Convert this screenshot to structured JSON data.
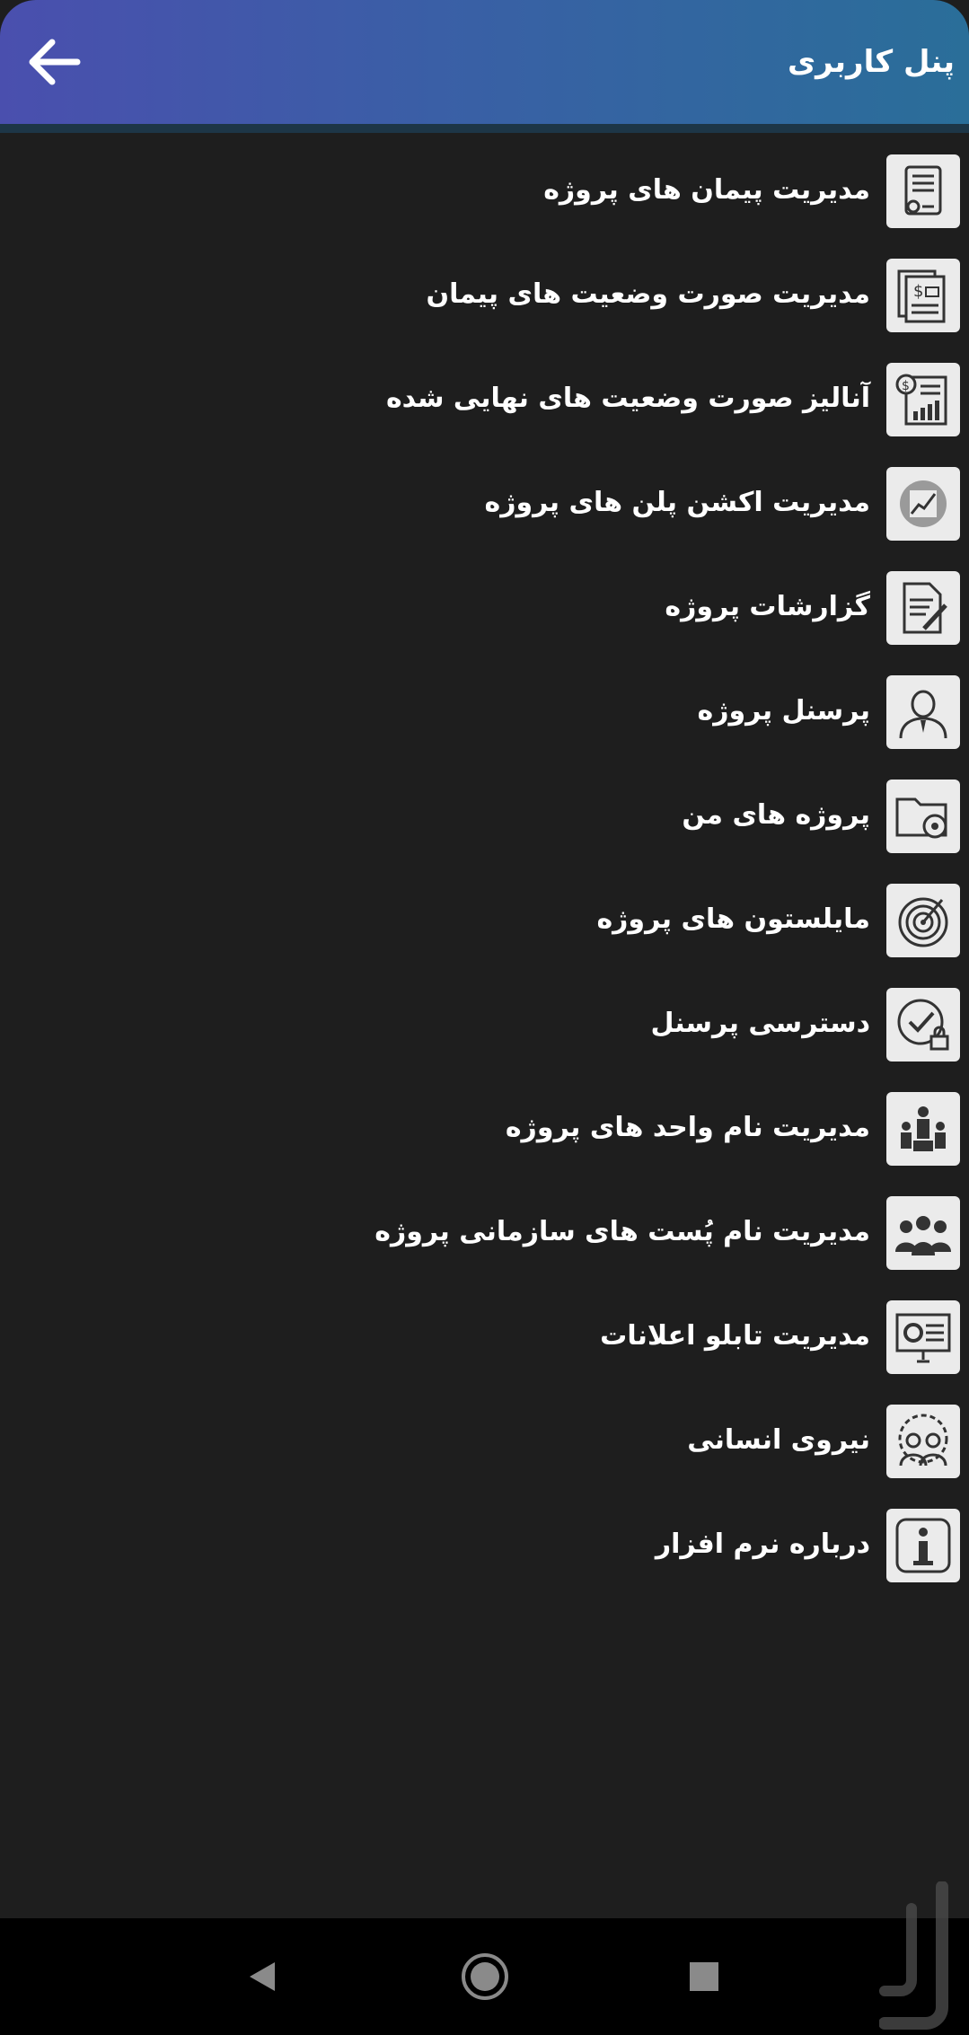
{
  "appbar": {
    "title": "پنل کاربری",
    "back_icon": "arrow-left-icon",
    "gradient": [
      "#4a4fae",
      "#2a6e99"
    ]
  },
  "menu": {
    "items": [
      {
        "label": "مدیریت پیمان های پروژه",
        "icon": "contract-document-icon"
      },
      {
        "label": "مدیریت صورت وضعیت های پیمان",
        "icon": "invoice-stack-icon"
      },
      {
        "label": "آنالیز صورت وضعیت های نهایی شده",
        "icon": "financial-report-icon"
      },
      {
        "label": "مدیریت اکشن پلن های پروژه",
        "icon": "trend-chart-icon"
      },
      {
        "label": "گزارشات پروژه",
        "icon": "report-edit-icon"
      },
      {
        "label": "پرسنل پروژه",
        "icon": "businessman-icon"
      },
      {
        "label": "پروژه های من",
        "icon": "folder-settings-icon"
      },
      {
        "label": "مایلستون های پروژه",
        "icon": "target-milestone-icon"
      },
      {
        "label": "دسترسی پرسنل",
        "icon": "access-check-lock-icon"
      },
      {
        "label": "مدیریت نام واحد های پروژه",
        "icon": "units-people-icon"
      },
      {
        "label": "مدیریت نام پُست های سازمانی پروژه",
        "icon": "team-positions-icon"
      },
      {
        "label": "مدیریت تابلو اعلانات",
        "icon": "notice-board-icon"
      },
      {
        "label": "نیروی انسانی",
        "icon": "workforce-gear-icon"
      },
      {
        "label": "درباره نرم افزار",
        "icon": "info-icon"
      }
    ]
  },
  "navbar": {
    "back_icon": "nav-back-triangle-icon",
    "home_icon": "nav-home-circle-icon",
    "recents_icon": "nav-recents-square-icon"
  },
  "colors": {
    "background": "#1e1e1e",
    "text": "#ffffff",
    "icon_tile": "#ebebeb",
    "navbar": "#000000"
  }
}
